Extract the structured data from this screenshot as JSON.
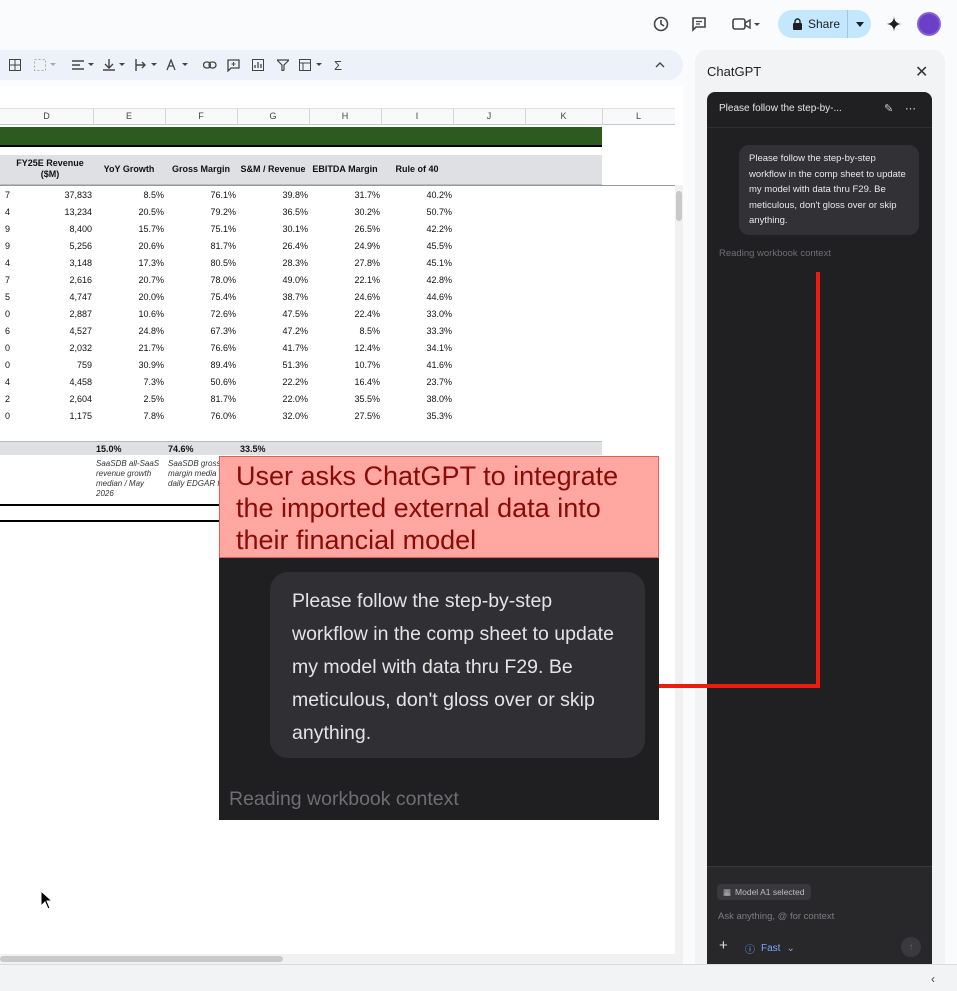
{
  "topbar": {
    "share_label": "Share",
    "icons": [
      "history-icon",
      "comment-icon",
      "video-icon",
      "lock-icon",
      "caret-down-icon",
      "gemini-spark-icon"
    ]
  },
  "colors": {
    "green_band": "#2d5a1f",
    "annotation_bg": "#ffa7a0",
    "annotation_text": "#8a0a05",
    "connector": "#ec1c10",
    "share_bg": "#c2e7ff",
    "chat_bg": "#202023"
  },
  "sheet": {
    "columns": [
      "D",
      "E",
      "F",
      "G",
      "H",
      "I",
      "J",
      "K",
      "L"
    ],
    "headers": {
      "revenue": "FY25E Revenue ($M)",
      "yoy": "YoY Growth",
      "gm": "Gross Margin",
      "sm": "S&M / Revenue",
      "ebitda": "EBITDA Margin",
      "rule40": "Rule of 40"
    },
    "rows": [
      {
        "lead": "7",
        "revenue": "37,833",
        "yoy": "8.5%",
        "gm": "76.1%",
        "sm": "39.8%",
        "ebitda": "31.7%",
        "rule40": "40.2%"
      },
      {
        "lead": "4",
        "revenue": "13,234",
        "yoy": "20.5%",
        "gm": "79.2%",
        "sm": "36.5%",
        "ebitda": "30.2%",
        "rule40": "50.7%"
      },
      {
        "lead": "9",
        "revenue": "8,400",
        "yoy": "15.7%",
        "gm": "75.1%",
        "sm": "30.1%",
        "ebitda": "26.5%",
        "rule40": "42.2%"
      },
      {
        "lead": "9",
        "revenue": "5,256",
        "yoy": "20.6%",
        "gm": "81.7%",
        "sm": "26.4%",
        "ebitda": "24.9%",
        "rule40": "45.5%"
      },
      {
        "lead": "4",
        "revenue": "3,148",
        "yoy": "17.3%",
        "gm": "80.5%",
        "sm": "28.3%",
        "ebitda": "27.8%",
        "rule40": "45.1%"
      },
      {
        "lead": "7",
        "revenue": "2,616",
        "yoy": "20.7%",
        "gm": "78.0%",
        "sm": "49.0%",
        "ebitda": "22.1%",
        "rule40": "42.8%"
      },
      {
        "lead": "5",
        "revenue": "4,747",
        "yoy": "20.0%",
        "gm": "75.4%",
        "sm": "38.7%",
        "ebitda": "24.6%",
        "rule40": "44.6%"
      },
      {
        "lead": "0",
        "revenue": "2,887",
        "yoy": "10.6%",
        "gm": "72.6%",
        "sm": "47.5%",
        "ebitda": "22.4%",
        "rule40": "33.0%"
      },
      {
        "lead": "6",
        "revenue": "4,527",
        "yoy": "24.8%",
        "gm": "67.3%",
        "sm": "47.2%",
        "ebitda": "8.5%",
        "rule40": "33.3%"
      },
      {
        "lead": "0",
        "revenue": "2,032",
        "yoy": "21.7%",
        "gm": "76.6%",
        "sm": "41.7%",
        "ebitda": "12.4%",
        "rule40": "34.1%"
      },
      {
        "lead": "0",
        "revenue": "759",
        "yoy": "30.9%",
        "gm": "89.4%",
        "sm": "51.3%",
        "ebitda": "10.7%",
        "rule40": "41.6%"
      },
      {
        "lead": "4",
        "revenue": "4,458",
        "yoy": "7.3%",
        "gm": "50.6%",
        "sm": "22.2%",
        "ebitda": "16.4%",
        "rule40": "23.7%"
      },
      {
        "lead": "2",
        "revenue": "2,604",
        "yoy": "2.5%",
        "gm": "81.7%",
        "sm": "22.0%",
        "ebitda": "35.5%",
        "rule40": "38.0%"
      },
      {
        "lead": "0",
        "revenue": "1,175",
        "yoy": "7.8%",
        "gm": "76.0%",
        "sm": "32.0%",
        "ebitda": "27.5%",
        "rule40": "35.3%"
      }
    ],
    "medians": {
      "yoy": "15.0%",
      "gm": "74.6%",
      "sm": "33.5%"
    },
    "notes": {
      "yoy": "SaaSDB all-SaaS revenue growth median / May 2026",
      "gm": "SaaSDB gross margin media daily EDGAR fi"
    }
  },
  "panel": {
    "title": "ChatGPT",
    "chat_title": "Please follow the step-by-...",
    "user_message": "Please follow the step-by-step workflow in the comp sheet to update my model with data thru F29. Be meticulous, don't gloss over or skip anything.",
    "status": "Reading workbook context",
    "model_chip": "Model A1 selected",
    "input_placeholder": "Ask anything, @ for context",
    "mode": "Fast"
  },
  "annotation": {
    "caption": "User asks ChatGPT to integrate the imported external data into their financial model",
    "zoom_message": "Please follow the step-by-step workflow in the comp sheet to update my model with data thru F29. Be meticulous, don't gloss over or skip anything.",
    "zoom_status": "Reading workbook context"
  }
}
